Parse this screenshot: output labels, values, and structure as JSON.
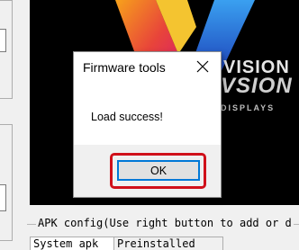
{
  "preview": {
    "brand_top": "VISION",
    "brand_big": "VSION",
    "brand_small": "DISPLAYS",
    "colors": {
      "logo_orange": "#f07820",
      "logo_pink": "#e0206a",
      "logo_blue": "#1a5fd0"
    }
  },
  "apk_config": {
    "label": "APK config(Use right button to add or d",
    "tabs": [
      "System apk",
      "Preinstalled"
    ]
  },
  "dialog": {
    "title": "Firmware tools",
    "message": "Load success!",
    "ok_label": "OK",
    "highlight_color": "#d0101a"
  }
}
